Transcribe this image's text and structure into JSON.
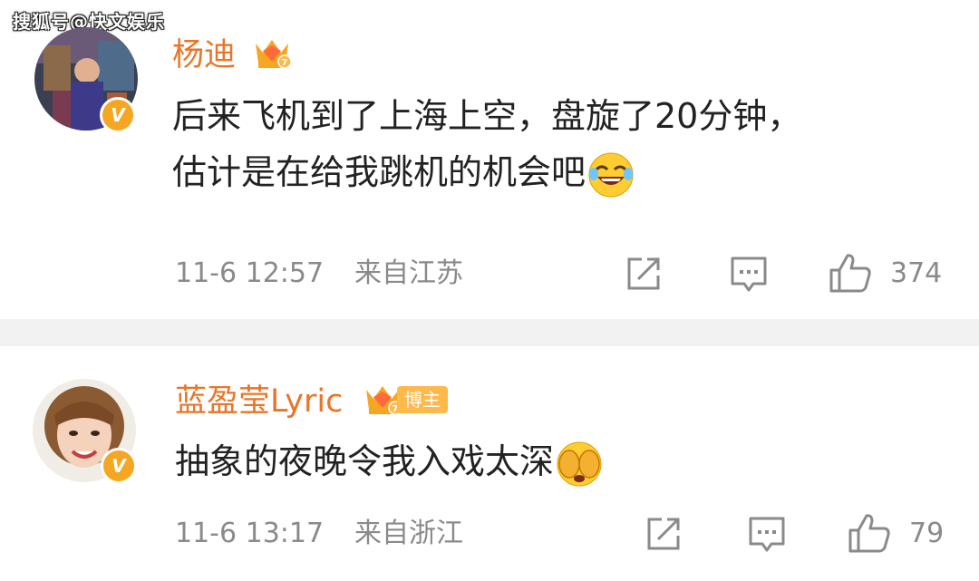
{
  "watermark": "搜狐号@快文娱乐",
  "comments": [
    {
      "username": "杨迪",
      "text_line1": "后来飞机到了上海上空，盘旋了20分钟，",
      "text_line2": "估计是在给我跳机的机会吧",
      "emoji": "laugh-cry-emoji",
      "time": "11-6 12:57",
      "location": "来自江苏",
      "likes": "374",
      "verified": "V",
      "vip_level": "7"
    },
    {
      "username": "蓝盈莹Lyric",
      "badge": "博主",
      "text_line1": "抽象的夜晚令我入戏太深",
      "emoji": "cover-face-emoji",
      "time": "11-6 13:17",
      "location": "来自浙江",
      "likes": "79",
      "verified": "V",
      "vip_level": "7"
    }
  ],
  "colors": {
    "username": "#e8762a",
    "meta": "#8a8a8a",
    "divider": "#f2f2f2",
    "verified": "#f5a623"
  },
  "icons": [
    "share-icon",
    "comment-icon",
    "like-icon",
    "crown-icon"
  ]
}
